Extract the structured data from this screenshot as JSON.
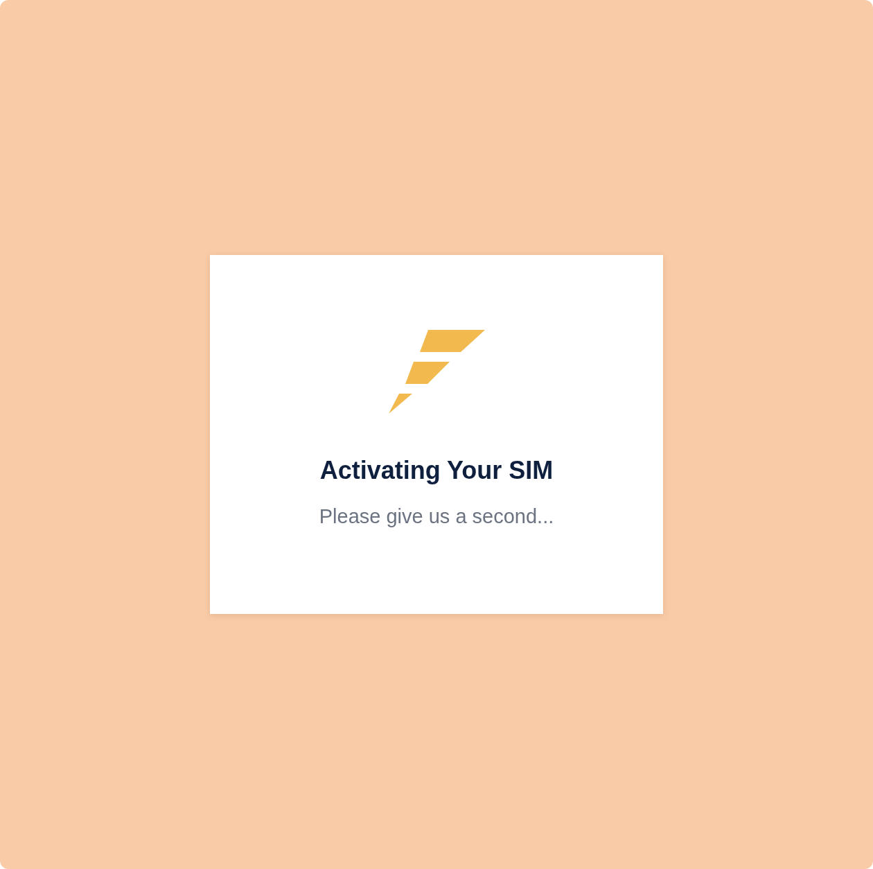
{
  "card": {
    "title": "Activating Your SIM",
    "subtitle": "Please give us a second..."
  }
}
